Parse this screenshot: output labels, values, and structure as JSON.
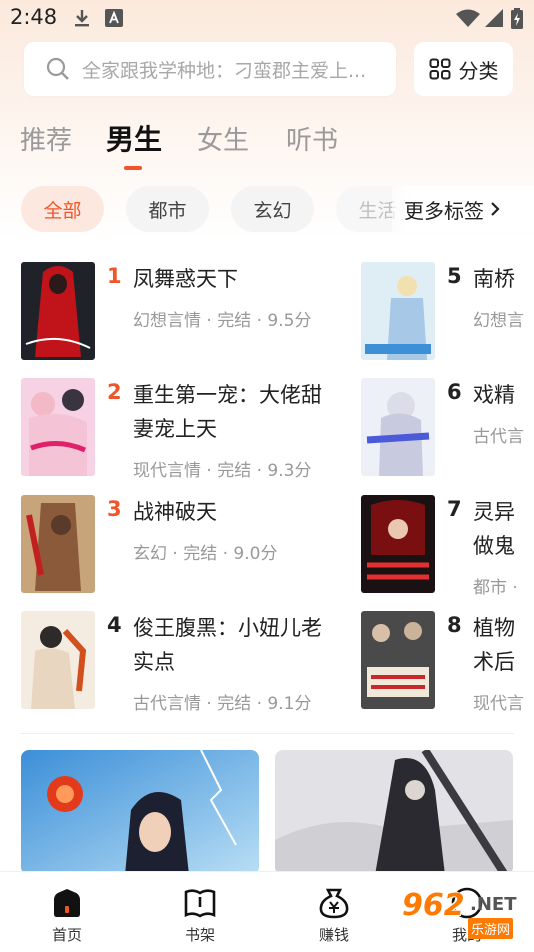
{
  "status_bar": {
    "time": "2:48"
  },
  "search": {
    "placeholder": "全家跟我学种地：刁蛮郡主爱上..."
  },
  "category_button": {
    "label": "分类"
  },
  "tabs": [
    {
      "label": "推荐"
    },
    {
      "label": "男生",
      "active": true
    },
    {
      "label": "女生"
    },
    {
      "label": "听书"
    }
  ],
  "chips": [
    {
      "label": "全部",
      "active": true
    },
    {
      "label": "都市"
    },
    {
      "label": "玄幻"
    },
    {
      "label": "生活"
    }
  ],
  "more_tags": {
    "label": "更多标签",
    "icon": "chevron-right-icon"
  },
  "rankings": [
    {
      "rank": "1",
      "title": "凤舞惑天下",
      "meta": "幻想言情 · 完结 · 9.5分"
    },
    {
      "rank": "2",
      "title": "重生第一宠：大佬甜妻宠上天",
      "title_line1": "重生第一宠：大佬甜",
      "title_line2": "妻宠上天",
      "meta": "现代言情 · 完结 · 9.3分"
    },
    {
      "rank": "3",
      "title": "战神破天",
      "meta": "玄幻 · 完结 · 9.0分"
    },
    {
      "rank": "4",
      "title": "俊王腹黑：小妞儿老实点",
      "title_line1": "俊王腹黑：小妞儿老",
      "title_line2": "实点",
      "meta": "古代言情 · 完结 · 9.1分"
    },
    {
      "rank": "5",
      "title": "南桥",
      "meta": "幻想言"
    },
    {
      "rank": "6",
      "title": "戏精",
      "meta": "古代言"
    },
    {
      "rank": "7",
      "title_line1": "灵异",
      "title_line2": "做鬼",
      "meta": "都市 ·"
    },
    {
      "rank": "8",
      "title_line1": "植物",
      "title_line2": "术后",
      "meta": "现代言"
    }
  ],
  "bottom_nav": [
    {
      "label": "首页",
      "icon": "home-icon",
      "active": true
    },
    {
      "label": "书架",
      "icon": "bookshelf-icon"
    },
    {
      "label": "赚钱",
      "icon": "money-bag-icon"
    },
    {
      "label": "我的",
      "icon": "profile-icon"
    }
  ],
  "watermark": {
    "brand": "962",
    "net": ".NET",
    "sub": "乐游网"
  },
  "colors": {
    "accent": "#f0552a",
    "chip_active_bg": "#fde8e0",
    "muted": "#999999"
  }
}
